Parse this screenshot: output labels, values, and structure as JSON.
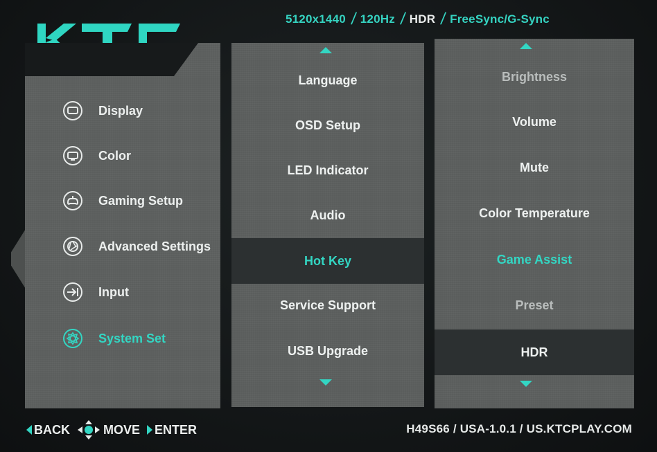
{
  "brand": {
    "logo_text": "KTC",
    "accent_color": "#33d6c3"
  },
  "top_info": {
    "resolution": "5120x1440",
    "refresh": "120Hz",
    "hdr": "HDR",
    "sync": "FreeSync/G-Sync"
  },
  "left_menu": {
    "items": [
      {
        "label": "Display",
        "icon": "display-icon"
      },
      {
        "label": "Color",
        "icon": "color-icon"
      },
      {
        "label": "Gaming Setup",
        "icon": "gamepad-icon"
      },
      {
        "label": "Advanced Settings",
        "icon": "aperture-icon"
      },
      {
        "label": "Input",
        "icon": "input-icon"
      },
      {
        "label": "System Set",
        "icon": "gear-icon",
        "active": true
      }
    ]
  },
  "middle_menu": {
    "items": [
      {
        "label": "Language"
      },
      {
        "label": "OSD Setup"
      },
      {
        "label": "LED Indicator"
      },
      {
        "label": "Audio"
      },
      {
        "label": "Hot Key",
        "selected": true
      },
      {
        "label": "Service Support"
      },
      {
        "label": "USB Upgrade"
      }
    ]
  },
  "right_menu": {
    "items": [
      {
        "label": "Brightness"
      },
      {
        "label": "Volume"
      },
      {
        "label": "Mute"
      },
      {
        "label": "Color Temperature"
      },
      {
        "label": "Game Assist"
      },
      {
        "label": "Preset"
      },
      {
        "label": "HDR",
        "selected": true
      }
    ]
  },
  "bottom_nav": {
    "back": "BACK",
    "move": "MOVE",
    "enter": "ENTER"
  },
  "footer": {
    "info": "H49S66 / USA-1.0.1 / US.KTCPLAY.COM"
  }
}
